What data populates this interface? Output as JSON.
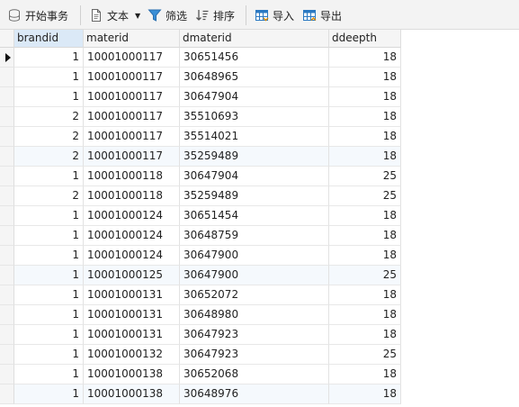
{
  "toolbar": {
    "begin_transaction": "开始事务",
    "text": "文本",
    "filter": "筛选",
    "sort": "排序",
    "import": "导入",
    "export": "导出"
  },
  "columns": [
    "brandid",
    "materid",
    "dmaterid",
    "ddeepth"
  ],
  "rows": [
    [
      "1",
      "10001000117",
      "30651456",
      "18"
    ],
    [
      "1",
      "10001000117",
      "30648965",
      "18"
    ],
    [
      "1",
      "10001000117",
      "30647904",
      "18"
    ],
    [
      "2",
      "10001000117",
      "35510693",
      "18"
    ],
    [
      "2",
      "10001000117",
      "35514021",
      "18"
    ],
    [
      "2",
      "10001000117",
      "35259489",
      "18"
    ],
    [
      "1",
      "10001000118",
      "30647904",
      "25"
    ],
    [
      "2",
      "10001000118",
      "35259489",
      "25"
    ],
    [
      "1",
      "10001000124",
      "30651454",
      "18"
    ],
    [
      "1",
      "10001000124",
      "30648759",
      "18"
    ],
    [
      "1",
      "10001000124",
      "30647900",
      "18"
    ],
    [
      "1",
      "10001000125",
      "30647900",
      "25"
    ],
    [
      "1",
      "10001000131",
      "30652072",
      "18"
    ],
    [
      "1",
      "10001000131",
      "30648980",
      "18"
    ],
    [
      "1",
      "10001000131",
      "30647923",
      "18"
    ],
    [
      "1",
      "10001000132",
      "30647923",
      "25"
    ],
    [
      "1",
      "10001000138",
      "30652068",
      "18"
    ],
    [
      "1",
      "10001000138",
      "30648976",
      "18"
    ]
  ],
  "colors": {
    "selected_header": "#dbe9f7",
    "alt_row": "#f5f9fd",
    "filter_icon": "#3a8fd6",
    "import_icon": "#2b79c2"
  },
  "icons": [
    "database-icon",
    "document-icon",
    "funnel-icon",
    "sort-icon",
    "table-import-icon",
    "table-export-icon"
  ]
}
